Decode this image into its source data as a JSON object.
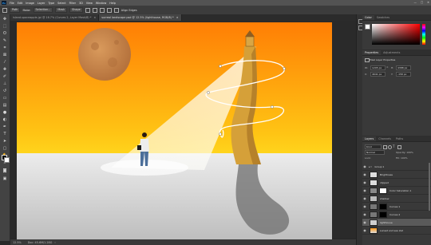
{
  "menu": {
    "app_icon": "Ps",
    "items": [
      "File",
      "Edit",
      "Image",
      "Layer",
      "Type",
      "Select",
      "Filter",
      "3D",
      "View",
      "Window",
      "Help"
    ],
    "window_controls": [
      "—",
      "□",
      "✕"
    ]
  },
  "options_bar": {
    "tool_label": "Path",
    "buttons": [
      "Make:",
      "Selection...",
      "Mask",
      "Shape"
    ],
    "align_edges_label": "Align Edges"
  },
  "tabs": [
    {
      "label": "island-spaceapple-jpi @ 16.7% (Curves 2, Layer Mask/8) *",
      "active": false
    },
    {
      "label": "surreal landscape psd @ 12.5% (lighthouse, RGB/8) *",
      "active": true
    }
  ],
  "status": {
    "zoom": "12.5%",
    "doc_size": "Doc: 45.6M/1.28G"
  },
  "panels": {
    "color_tabs": [
      "Color",
      "Swatches"
    ],
    "properties_tabs": [
      "Properties",
      "Adjustments"
    ],
    "properties_title": "Pixel Layer Properties",
    "props": {
      "w_label": "W:",
      "w_value": "1205 px",
      "h_label": "H:",
      "h_value": "4388 px",
      "x_label": "X:",
      "x_value": "4641 px",
      "y_label": "Y:",
      "y_value": "-158 px"
    },
    "layers_tabs": [
      "Layers",
      "Channels",
      "Paths"
    ],
    "kind_label": "Kind",
    "blend_mode": "Normal",
    "opacity_label": "Opacity: 100%",
    "fill_label": "Fill: 100%",
    "lock_label": "Lock:",
    "layers": [
      {
        "name": "Group 1"
      },
      {
        "name": "Brightness"
      },
      {
        "name": "clipped"
      },
      {
        "name": "Color Saturation 1"
      },
      {
        "name": "shadow"
      },
      {
        "name": "Curves 1"
      },
      {
        "name": "Curves 2"
      },
      {
        "name": "lighthouse"
      },
      {
        "name": "sunset and sea 2sd"
      }
    ]
  },
  "colors": {
    "sky_top": "#ff7e05",
    "sky_bottom": "#ffd419",
    "ground": "#d4d4d4",
    "moon": "#c9844a",
    "tower": "#d7a13a",
    "accent": "#31a8ff"
  }
}
